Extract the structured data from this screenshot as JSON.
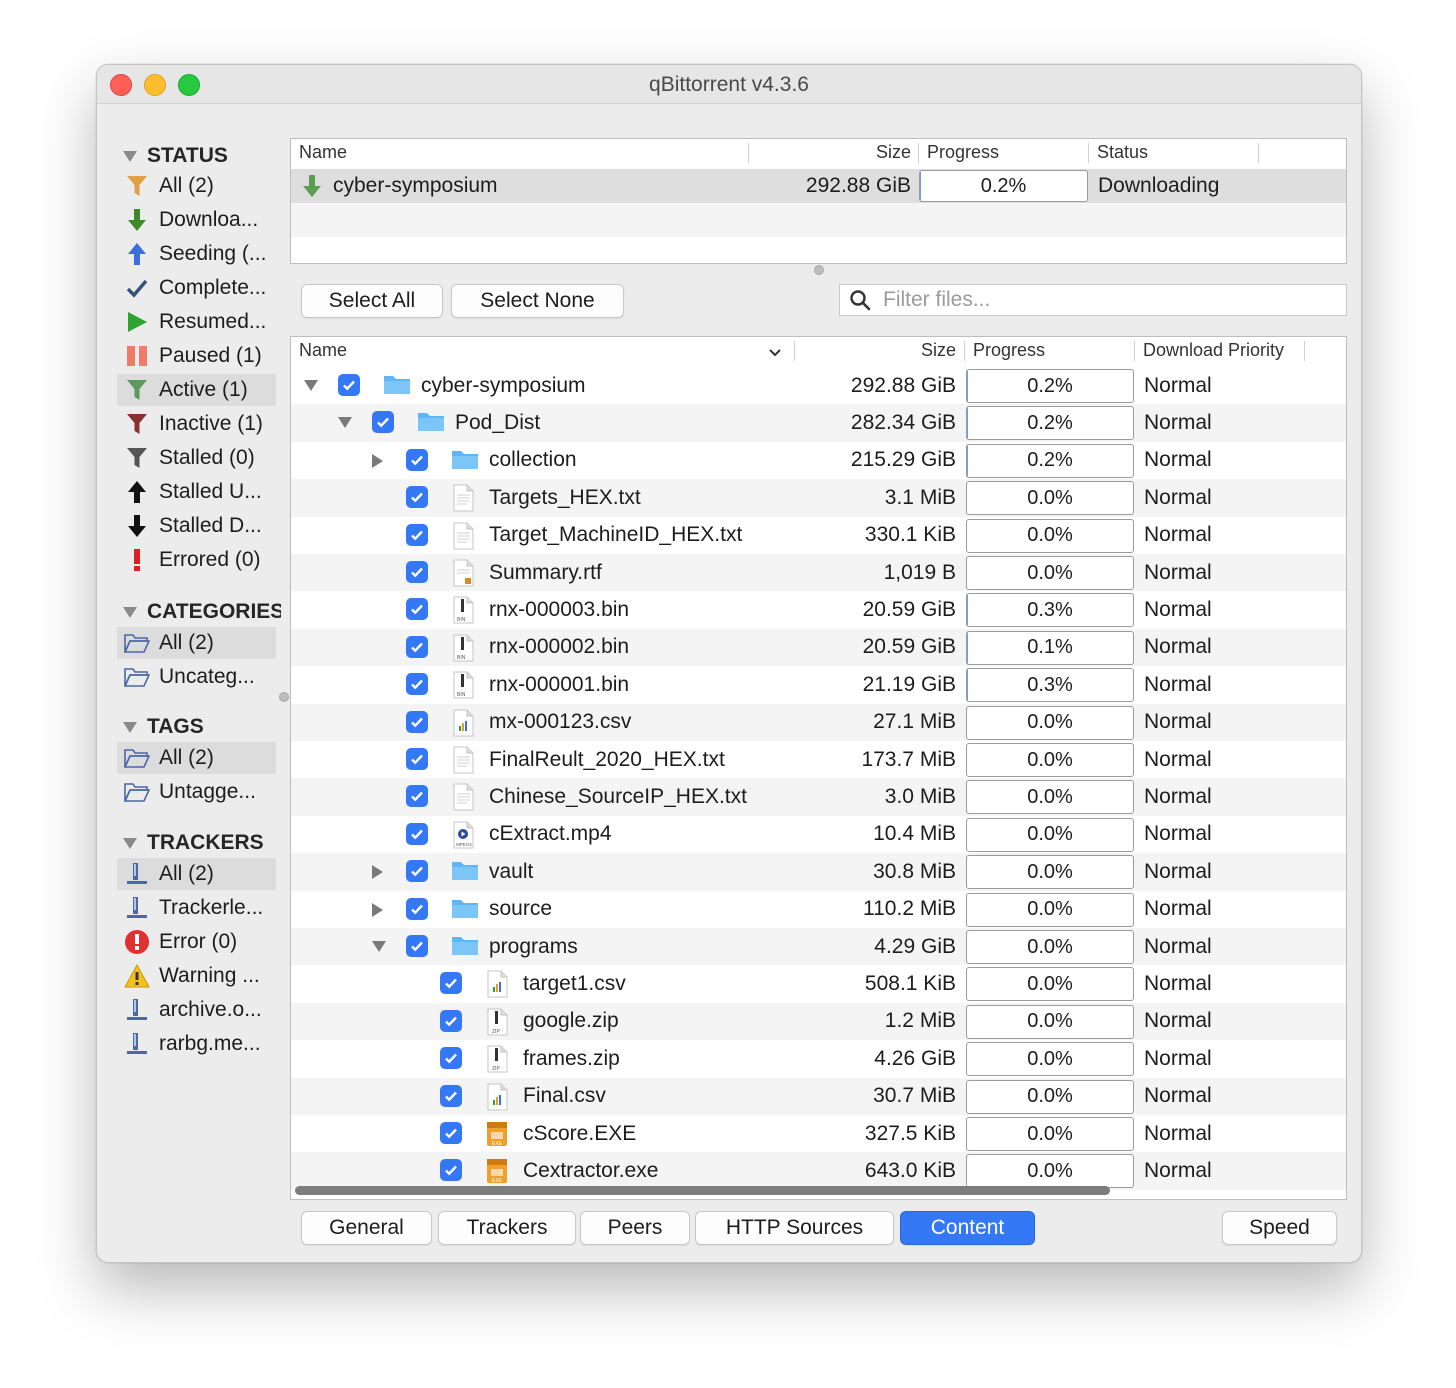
{
  "window": {
    "title": "qBittorrent v4.3.6"
  },
  "sidebar": {
    "status": {
      "heading": "STATUS",
      "items": [
        {
          "label": "All (2)",
          "icon": "filter-icon",
          "color": "#e0a043"
        },
        {
          "label": "Downloa...",
          "icon": "arrow-down-icon",
          "color": "#3e8a2a"
        },
        {
          "label": "Seeding (...",
          "icon": "arrow-up-icon",
          "color": "#3b6fe0"
        },
        {
          "label": "Complete...",
          "icon": "checkmark-icon",
          "color": "#36547a"
        },
        {
          "label": "Resumed...",
          "icon": "play-icon",
          "color": "#2ea32e"
        },
        {
          "label": "Paused (1)",
          "icon": "pause-icon",
          "color": "#f07c68"
        },
        {
          "label": "Active (1)",
          "icon": "filter-icon",
          "color": "#5a9a5a"
        },
        {
          "label": "Inactive (1)",
          "icon": "filter-icon",
          "color": "#8a3030"
        },
        {
          "label": "Stalled (0)",
          "icon": "filter-icon",
          "color": "#555555"
        },
        {
          "label": "Stalled U...",
          "icon": "arrow-up-icon",
          "color": "#111111"
        },
        {
          "label": "Stalled D...",
          "icon": "arrow-down-icon",
          "color": "#111111"
        },
        {
          "label": "Errored (0)",
          "icon": "exclamation-icon",
          "color": "#e02020"
        }
      ]
    },
    "categories": {
      "heading": "CATEGORIES",
      "items": [
        {
          "label": "All (2)"
        },
        {
          "label": "Uncateg..."
        }
      ]
    },
    "tags": {
      "heading": "TAGS",
      "items": [
        {
          "label": "All (2)"
        },
        {
          "label": "Untagge..."
        }
      ]
    },
    "trackers": {
      "heading": "TRACKERS",
      "items": [
        {
          "label": "All (2)",
          "icon": "tracker-icon"
        },
        {
          "label": "Trackerle...",
          "icon": "tracker-icon"
        },
        {
          "label": "Error (0)",
          "icon": "error-icon"
        },
        {
          "label": "Warning ...",
          "icon": "warning-icon"
        },
        {
          "label": "archive.o...",
          "icon": "tracker-icon"
        },
        {
          "label": "rarbg.me...",
          "icon": "tracker-icon"
        }
      ]
    }
  },
  "torrent_list": {
    "columns": [
      "Name",
      "Size",
      "Progress",
      "Status"
    ],
    "rows": [
      {
        "name": "cyber-symposium",
        "size": "292.88 GiB",
        "progress": "0.2%",
        "progress_value": 0.2,
        "status": "Downloading"
      }
    ]
  },
  "toolbar": {
    "select_all": "Select All",
    "select_none": "Select None",
    "filter_placeholder": "Filter files..."
  },
  "content": {
    "columns": [
      "Name",
      "Size",
      "Progress",
      "Download Priority"
    ],
    "rows": [
      {
        "name": "cyber-symposium",
        "size": "292.88 GiB",
        "progress": "0.2%",
        "value": 0.2,
        "priority": "Normal",
        "depth": 0,
        "type": "folder",
        "expand": "open"
      },
      {
        "name": "Pod_Dist",
        "size": "282.34 GiB",
        "progress": "0.2%",
        "value": 0.2,
        "priority": "Normal",
        "depth": 1,
        "type": "folder",
        "expand": "open"
      },
      {
        "name": "collection",
        "size": "215.29 GiB",
        "progress": "0.2%",
        "value": 0.2,
        "priority": "Normal",
        "depth": 2,
        "type": "folder",
        "expand": "closed"
      },
      {
        "name": "Targets_HEX.txt",
        "size": "3.1 MiB",
        "progress": "0.0%",
        "value": 0,
        "priority": "Normal",
        "depth": 2,
        "type": "txt"
      },
      {
        "name": "Target_MachineID_HEX.txt",
        "size": "330.1 KiB",
        "progress": "0.0%",
        "value": 0,
        "priority": "Normal",
        "depth": 2,
        "type": "txt"
      },
      {
        "name": "Summary.rtf",
        "size": "1,019 B",
        "progress": "0.0%",
        "value": 0,
        "priority": "Normal",
        "depth": 2,
        "type": "rtf"
      },
      {
        "name": "rnx-000003.bin",
        "size": "20.59 GiB",
        "progress": "0.3%",
        "value": 0.3,
        "priority": "Normal",
        "depth": 2,
        "type": "bin"
      },
      {
        "name": "rnx-000002.bin",
        "size": "20.59 GiB",
        "progress": "0.1%",
        "value": 0.1,
        "priority": "Normal",
        "depth": 2,
        "type": "bin"
      },
      {
        "name": "rnx-000001.bin",
        "size": "21.19 GiB",
        "progress": "0.3%",
        "value": 0.3,
        "priority": "Normal",
        "depth": 2,
        "type": "bin"
      },
      {
        "name": "mx-000123.csv",
        "size": "27.1 MiB",
        "progress": "0.0%",
        "value": 0,
        "priority": "Normal",
        "depth": 2,
        "type": "csv"
      },
      {
        "name": "FinalReult_2020_HEX.txt",
        "size": "173.7 MiB",
        "progress": "0.0%",
        "value": 0,
        "priority": "Normal",
        "depth": 2,
        "type": "txt"
      },
      {
        "name": "Chinese_SourceIP_HEX.txt",
        "size": "3.0 MiB",
        "progress": "0.0%",
        "value": 0,
        "priority": "Normal",
        "depth": 2,
        "type": "txt"
      },
      {
        "name": "cExtract.mp4",
        "size": "10.4 MiB",
        "progress": "0.0%",
        "value": 0,
        "priority": "Normal",
        "depth": 2,
        "type": "mp4"
      },
      {
        "name": "vault",
        "size": "30.8 MiB",
        "progress": "0.0%",
        "value": 0,
        "priority": "Normal",
        "depth": 2,
        "type": "folder",
        "expand": "closed"
      },
      {
        "name": "source",
        "size": "110.2 MiB",
        "progress": "0.0%",
        "value": 0,
        "priority": "Normal",
        "depth": 2,
        "type": "folder",
        "expand": "closed"
      },
      {
        "name": "programs",
        "size": "4.29 GiB",
        "progress": "0.0%",
        "value": 0,
        "priority": "Normal",
        "depth": 2,
        "type": "folder",
        "expand": "open"
      },
      {
        "name": "target1.csv",
        "size": "508.1 KiB",
        "progress": "0.0%",
        "value": 0,
        "priority": "Normal",
        "depth": 3,
        "type": "csv"
      },
      {
        "name": "google.zip",
        "size": "1.2 MiB",
        "progress": "0.0%",
        "value": 0,
        "priority": "Normal",
        "depth": 3,
        "type": "zip"
      },
      {
        "name": "frames.zip",
        "size": "4.26 GiB",
        "progress": "0.0%",
        "value": 0,
        "priority": "Normal",
        "depth": 3,
        "type": "zip"
      },
      {
        "name": "Final.csv",
        "size": "30.7 MiB",
        "progress": "0.0%",
        "value": 0,
        "priority": "Normal",
        "depth": 3,
        "type": "csv"
      },
      {
        "name": "cScore.EXE",
        "size": "327.5 KiB",
        "progress": "0.0%",
        "value": 0,
        "priority": "Normal",
        "depth": 3,
        "type": "exe"
      },
      {
        "name": "Cextractor.exe",
        "size": "643.0 KiB",
        "progress": "0.0%",
        "value": 0,
        "priority": "Normal",
        "depth": 3,
        "type": "exe"
      }
    ]
  },
  "tabs": [
    {
      "label": "General",
      "active": false
    },
    {
      "label": "Trackers",
      "active": false
    },
    {
      "label": "Peers",
      "active": false
    },
    {
      "label": "HTTP Sources",
      "active": false
    },
    {
      "label": "Content",
      "active": true
    }
  ],
  "speed_button": "Speed",
  "colors": {
    "accent": "#3478f6",
    "folder": "#5fb6f5",
    "progress_fill": "#6aa0e6"
  }
}
